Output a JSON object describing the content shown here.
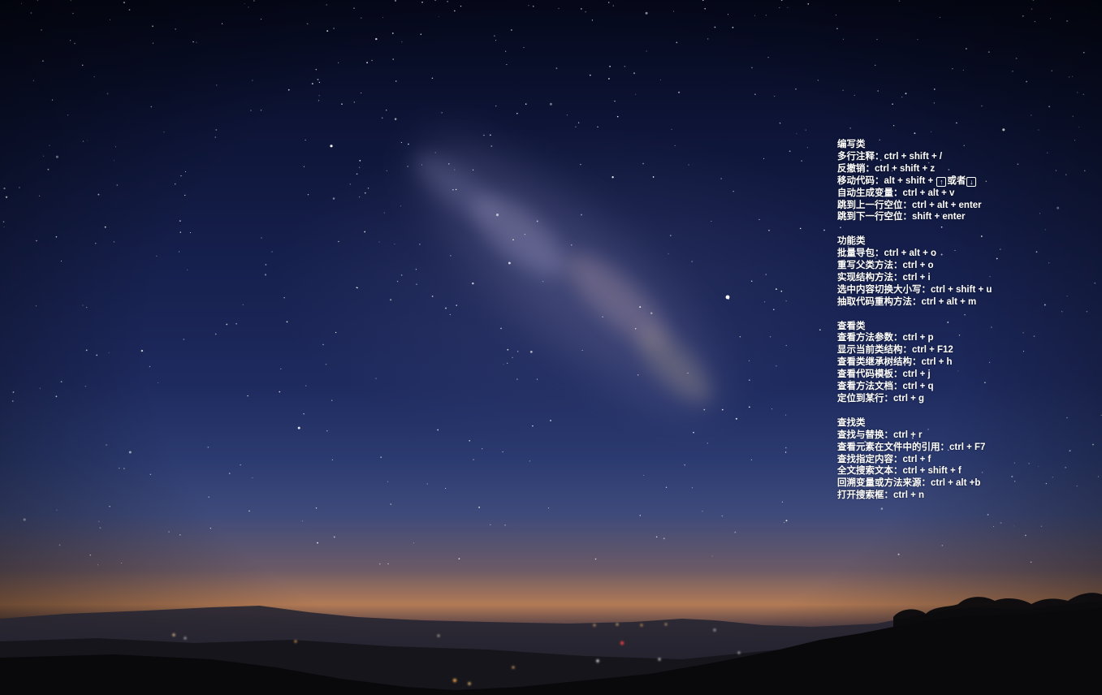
{
  "wallpaper": {
    "sky_colors": [
      "#05081a",
      "#1e2a5e",
      "#b27a55",
      "#0c0c12"
    ]
  },
  "cheatsheet": {
    "sections": [
      {
        "title": "编写类",
        "items": [
          "多行注释：ctrl + shift + /",
          "反撤销：ctrl + shift + z",
          "自动生成变量：ctrl + alt + v",
          "跳到上一行空位：ctrl + alt + enter",
          "跳到下一行空位：shift + enter"
        ],
        "move_code": {
          "prefix": "移动代码：alt + shift + ",
          "up_icon": "arrow-up-icon",
          "middle": "或者",
          "down_icon": "arrow-down-icon"
        }
      },
      {
        "title": "功能类",
        "items": [
          "批量导包：ctrl + alt + o",
          "重写父类方法：ctrl + o",
          "实现结构方法：ctrl + i",
          "选中内容切换大小写：ctrl + shift + u",
          "抽取代码重构方法：ctrl + alt + m"
        ]
      },
      {
        "title": "查看类",
        "items": [
          "查看方法参数：ctrl + p",
          "显示当前类结构：ctrl + F12",
          "查看类继承树结构：ctrl + h",
          "查看代码模板：ctrl + j",
          "查看方法文档：ctrl + q",
          "定位到某行：ctrl + g"
        ]
      },
      {
        "title": "查找类",
        "items": [
          "查找与替换：ctrl + r",
          "查看元素在文件中的引用：ctrl + F7",
          "查找指定内容：ctrl + f",
          "全文搜索文本：ctrl + shift + f",
          "回溯变量或方法来源：ctrl + alt +b",
          "打开搜索框：ctrl + n"
        ]
      }
    ]
  }
}
